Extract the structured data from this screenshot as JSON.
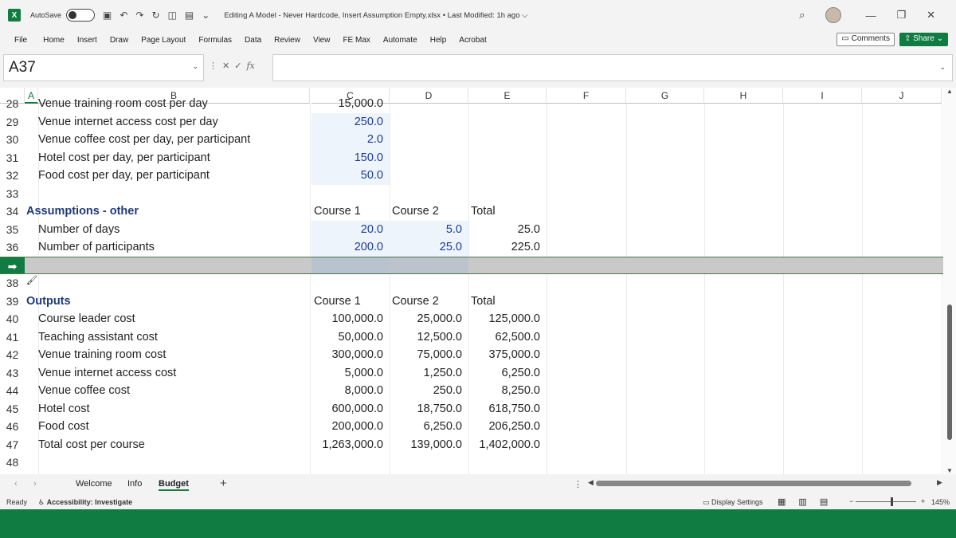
{
  "titlebar": {
    "app_icon": "X",
    "autosave_label": "AutoSave",
    "doc_title": "Editing A Model - Never Hardcode, Insert Assumption Empty.xlsx • Last Modified: 1h ago ⌵"
  },
  "menu": {
    "items": [
      "File",
      "Home",
      "Insert",
      "Draw",
      "Page Layout",
      "Formulas",
      "Data",
      "Review",
      "View",
      "FE Max",
      "Automate",
      "Help",
      "Acrobat"
    ],
    "comments_label": "Comments",
    "share_label": "Share"
  },
  "formula_bar": {
    "name_box": "A37",
    "fx": "fx",
    "formula": ""
  },
  "columns": [
    "A",
    "B",
    "C",
    "D",
    "E",
    "F",
    "G",
    "H",
    "I",
    "J"
  ],
  "rows": [
    {
      "num": "28",
      "B": "Venue training room cost per day",
      "C": "15,000.0",
      "partial": true
    },
    {
      "num": "29",
      "B": "Venue internet access cost per day",
      "C": "250.0",
      "input": [
        "C"
      ]
    },
    {
      "num": "30",
      "B": "Venue coffee cost per day, per participant",
      "C": "2.0",
      "input": [
        "C"
      ]
    },
    {
      "num": "31",
      "B": "Hotel cost per day, per participant",
      "C": "150.0",
      "input": [
        "C"
      ]
    },
    {
      "num": "32",
      "B": "Food cost per day, per participant",
      "C": "50.0",
      "input": [
        "C"
      ]
    },
    {
      "num": "33"
    },
    {
      "num": "34",
      "A": "Assumptions - other",
      "C": "Course 1",
      "D": "Course 2",
      "E": "Total",
      "section": true,
      "header": true
    },
    {
      "num": "35",
      "B": "Number of days",
      "C": "20.0",
      "D": "5.0",
      "E": "25.0",
      "input": [
        "C",
        "D"
      ]
    },
    {
      "num": "36",
      "B": "Number of participants",
      "C": "200.0",
      "D": "25.0",
      "E": "225.0",
      "input": [
        "C",
        "D"
      ]
    },
    {
      "num": "",
      "selected": true
    },
    {
      "num": "38"
    },
    {
      "num": "39",
      "A": "Outputs",
      "C": "Course 1",
      "D": "Course 2",
      "E": "Total",
      "section": true,
      "header": true
    },
    {
      "num": "40",
      "B": "Course leader cost",
      "C": "100,000.0",
      "D": "25,000.0",
      "E": "125,000.0"
    },
    {
      "num": "41",
      "B": "Teaching assistant cost",
      "C": "50,000.0",
      "D": "12,500.0",
      "E": "62,500.0"
    },
    {
      "num": "42",
      "B": "Venue training room cost",
      "C": "300,000.0",
      "D": "75,000.0",
      "E": "375,000.0"
    },
    {
      "num": "43",
      "B": "Venue internet access cost",
      "C": "5,000.0",
      "D": "1,250.0",
      "E": "6,250.0"
    },
    {
      "num": "44",
      "B": "Venue coffee cost",
      "C": "8,000.0",
      "D": "250.0",
      "E": "8,250.0"
    },
    {
      "num": "45",
      "B": "Hotel cost",
      "C": "600,000.0",
      "D": "18,750.0",
      "E": "618,750.0"
    },
    {
      "num": "46",
      "B": "Food cost",
      "C": "200,000.0",
      "D": "6,250.0",
      "E": "206,250.0"
    },
    {
      "num": "47",
      "B": "Total cost per course",
      "C": "1,263,000.0",
      "D": "139,000.0",
      "E": "1,402,000.0"
    },
    {
      "num": "48"
    }
  ],
  "sheet_tabs": [
    "Welcome",
    "Info",
    "Budget"
  ],
  "active_tab": "Budget",
  "status": {
    "ready": "Ready",
    "accessibility": "Accessibility: Investigate",
    "display_settings": "Display Settings",
    "zoom": "145%"
  },
  "colors": {
    "accent": "#107c41",
    "input_text": "#1a3a9a",
    "input_fill": "#eef4fc",
    "section_text": "#1f3a7a"
  }
}
